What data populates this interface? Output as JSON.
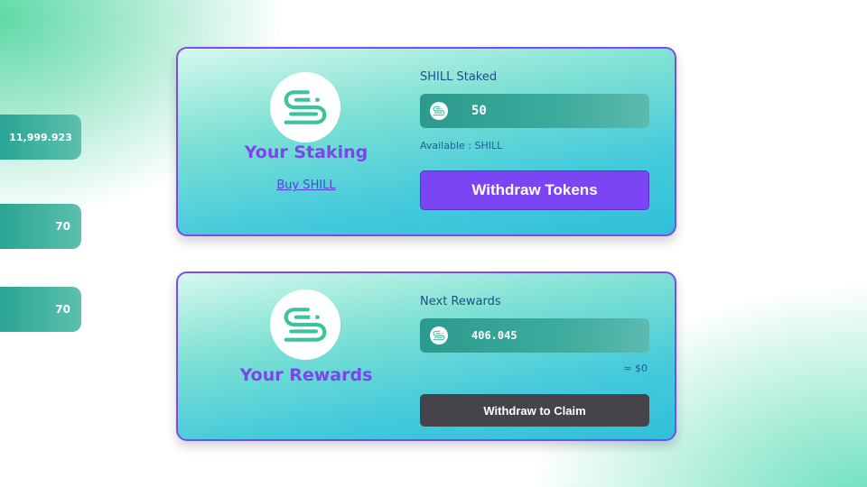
{
  "colors": {
    "accent_purple": "#7b45f4",
    "title_purple": "#7b45ea",
    "brand_green": "#3cc39a",
    "dark_button": "#46444b"
  },
  "side_stats": [
    "11,999.923",
    "70",
    "70"
  ],
  "staking": {
    "logo_icon": "shill-logo-icon",
    "title": "Your Staking",
    "buy_link": "Buy SHILL",
    "field_label": "SHILL Staked",
    "token_icon": "shill-token-icon",
    "value": "50",
    "available": "Available : SHILL",
    "button": "Withdraw Tokens"
  },
  "rewards": {
    "logo_icon": "shill-logo-icon",
    "title": "Your Rewards",
    "field_label": "Next Rewards",
    "token_icon": "shill-token-icon",
    "value": "406.045",
    "approx": "≈ $0",
    "button": "Withdraw to Claim"
  }
}
